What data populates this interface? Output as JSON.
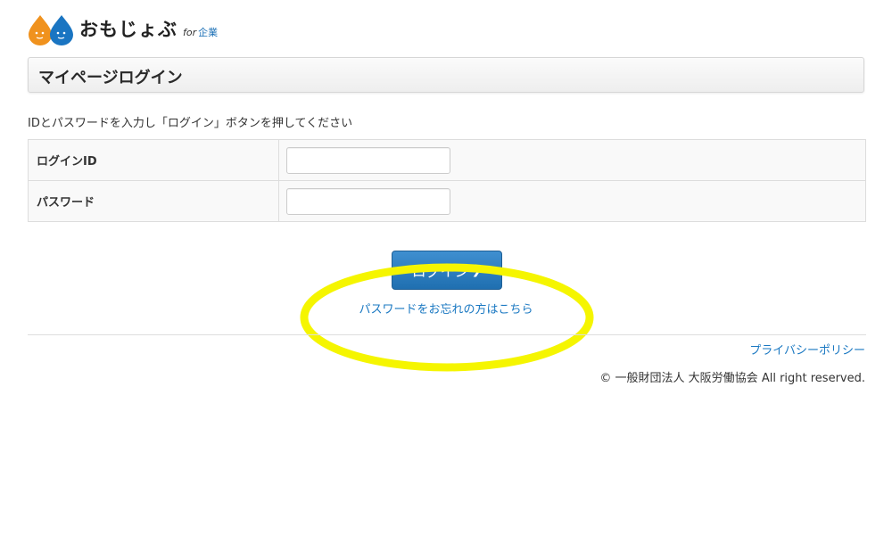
{
  "logo": {
    "name": "おもじょぶ",
    "for": "for",
    "kigyo": "企業",
    "colors": {
      "left_drop": "#f0921e",
      "right_drop": "#1a75c2"
    }
  },
  "title": "マイページログイン",
  "instructions": "IDとパスワードを入力し「ログイン」ボタンを押してください",
  "form": {
    "fields": [
      {
        "label": "ログインID",
        "value": "",
        "placeholder": ""
      },
      {
        "label": "パスワード",
        "value": "",
        "placeholder": ""
      }
    ]
  },
  "login_button": {
    "label": "ログイン",
    "icon": "chevron-right-icon"
  },
  "forgot_password_link": "パスワードをお忘れの方はこちら",
  "annotation": {
    "shape": "ellipse",
    "color": "#f5f500"
  },
  "footer": {
    "privacy_link": "プライバシーポリシー",
    "copyright": "© 一般財団法人 大阪労働協会 All right reserved."
  },
  "colors": {
    "link": "#1a78c2",
    "button_top": "#3f8fd0",
    "button_bottom": "#1f6fb0"
  }
}
